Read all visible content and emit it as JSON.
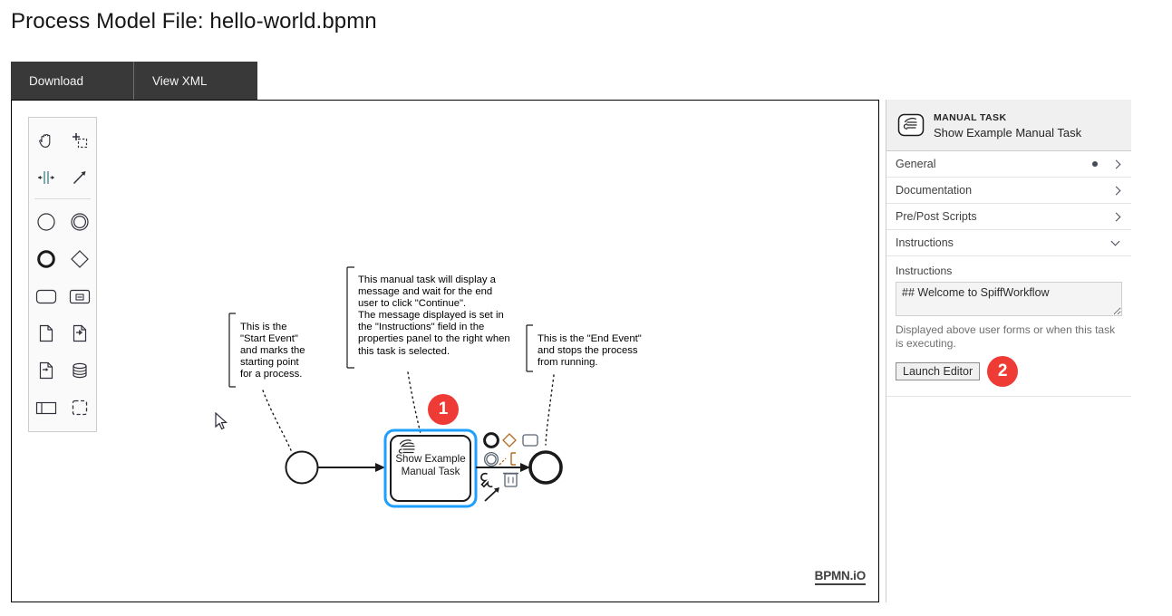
{
  "page": {
    "title": "Process Model File: hello-world.bpmn"
  },
  "tabs": [
    {
      "label": "Download",
      "name": "tab-download"
    },
    {
      "label": "View XML",
      "name": "tab-view-xml"
    }
  ],
  "canvas": {
    "logo": "BPMN.iO",
    "palette": [
      {
        "icon": "hand-tool-icon",
        "label": "Activate the hand tool"
      },
      {
        "icon": "lasso-tool-icon",
        "label": "Activate the lasso tool"
      },
      {
        "icon": "space-tool-icon",
        "label": "Activate the create/remove space tool"
      },
      {
        "icon": "global-connect-tool-icon",
        "label": "Activate the global connect tool"
      },
      {
        "icon": "start-event-icon",
        "label": "Create StartEvent"
      },
      {
        "icon": "intermediate-event-icon",
        "label": "Create Intermediate/Boundary Event"
      },
      {
        "icon": "end-event-icon",
        "label": "Create EndEvent"
      },
      {
        "icon": "gateway-icon",
        "label": "Create Gateway"
      },
      {
        "icon": "task-icon",
        "label": "Create Task"
      },
      {
        "icon": "subprocess-icon",
        "label": "Create expanded SubProcess"
      },
      {
        "icon": "data-object-icon",
        "label": "Create DataObjectReference"
      },
      {
        "icon": "data-input-icon",
        "label": "Create DataInput"
      },
      {
        "icon": "data-output-icon",
        "label": "Create DataOutput"
      },
      {
        "icon": "data-store-icon",
        "label": "Create DataStoreReference"
      },
      {
        "icon": "participant-icon",
        "label": "Create Pool/Participant"
      },
      {
        "icon": "group-icon",
        "label": "Create Group"
      }
    ],
    "annotations": {
      "start_event": "This is the\n\"Start Event\"\nand marks the\nstarting point\nfor a process.",
      "manual_task": "This manual task will display a\nmessage and wait for the end\nuser to click \"Continue\".\nThe message displayed is set in\nthe \"Instructions\" field in the\nproperties panel to the right when\nthis task is selected.",
      "end_event": "This is the \"End Event\"\nand stops the process\nfrom running."
    },
    "task": {
      "label_line1": "Show Example",
      "label_line2": "Manual Task"
    },
    "context_pad": [
      {
        "icon": "append-end-event-icon"
      },
      {
        "icon": "append-gateway-icon"
      },
      {
        "icon": "append-task-icon"
      },
      {
        "icon": "append-intermediate-event-icon"
      },
      {
        "icon": "append-text-annotation-icon"
      },
      {
        "icon": "wrench-icon"
      },
      {
        "icon": "trash-icon"
      },
      {
        "icon": "connect-arrow-icon"
      }
    ]
  },
  "badges": {
    "one": "1",
    "two": "2"
  },
  "properties": {
    "header": {
      "type": "MANUAL TASK",
      "name": "Show Example Manual Task",
      "icon": "manual-task-icon"
    },
    "groups": [
      {
        "label": "General",
        "name": "general",
        "expanded": false,
        "dot": true
      },
      {
        "label": "Documentation",
        "name": "documentation",
        "expanded": false,
        "dot": false
      },
      {
        "label": "Pre/Post Scripts",
        "name": "pre-post-scripts",
        "expanded": false,
        "dot": false
      },
      {
        "label": "Instructions",
        "name": "instructions",
        "expanded": true,
        "dot": false
      }
    ],
    "instructions": {
      "field_label": "Instructions",
      "value": "## Welcome to SpiffWorkflow",
      "help": "Displayed above user forms or when this task is executing.",
      "button_label": "Launch Editor"
    }
  },
  "colors": {
    "tab_bar_bg": "#393939",
    "badge_red": "#ee3b35",
    "selection_blue": "#1e9ffc",
    "panel_header_bg": "#f0f0f0"
  }
}
